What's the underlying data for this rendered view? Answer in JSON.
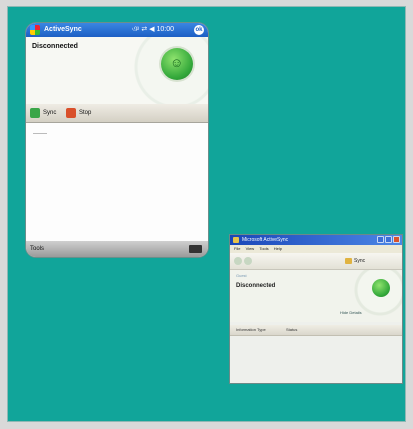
{
  "pocket_pc": {
    "title": "ActiveSync",
    "status_icons": "ঞ ⇄ ◀ 10:00",
    "ok_label": "ok",
    "banner_title": "Disconnected",
    "toolbar": {
      "sync_label": "Sync",
      "stop_label": "Stop"
    },
    "menu": {
      "tools_label": "Tools"
    }
  },
  "desktop_window": {
    "title": "Microsoft ActiveSync",
    "menu": [
      "File",
      "View",
      "Tools",
      "Help"
    ],
    "sync_button_label": "Sync",
    "guest_label": "Guest",
    "heading": "Disconnected",
    "detail_link": "Hide Details",
    "columns": [
      "Information Type",
      "Status"
    ]
  }
}
